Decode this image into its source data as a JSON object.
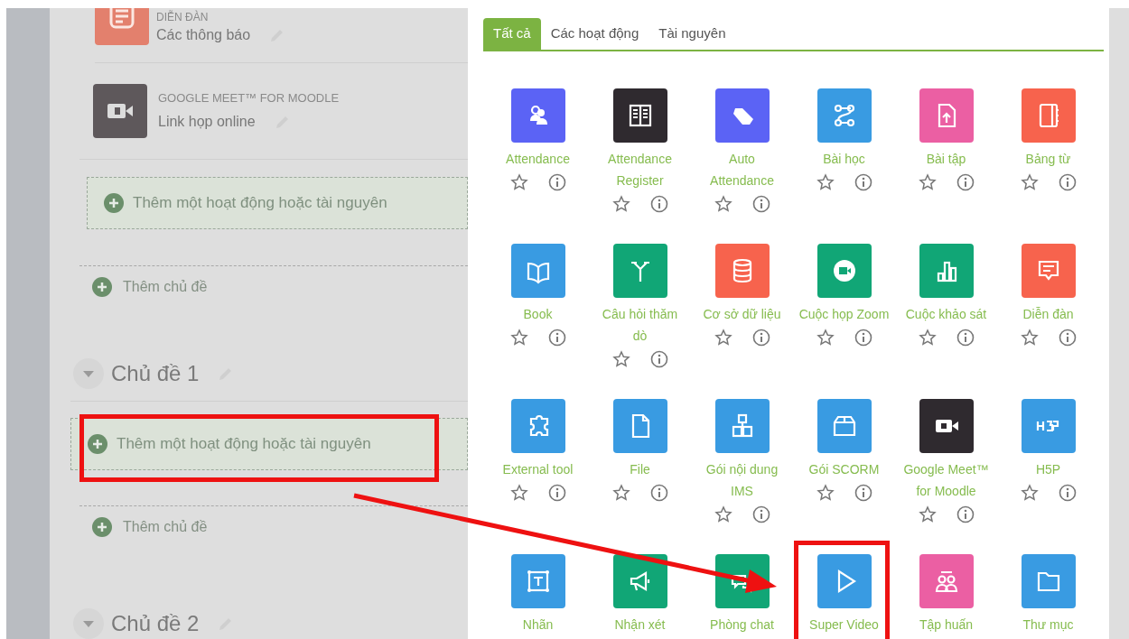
{
  "course": {
    "activities": [
      {
        "type_label": "DIỄN ĐÀN",
        "name": "Các thông báo",
        "color": "#e3806d"
      },
      {
        "type_label": "GOOGLE MEET™ FOR MOODLE",
        "name": "Link họp online",
        "color": "#5e585b"
      }
    ],
    "add_activity": "Thêm một hoạt động hoặc tài nguyên",
    "add_topic": "Thêm chủ đề",
    "sections": [
      {
        "title": "Chủ đề 1",
        "add_activity": "Thêm một hoạt động hoặc tài nguyên",
        "add_topic": "Thêm chủ đề"
      },
      {
        "title": "Chủ đề 2"
      }
    ]
  },
  "chooser": {
    "tabs": [
      {
        "label": "Tất cả",
        "selected": true
      },
      {
        "label": "Các hoạt động",
        "selected": false
      },
      {
        "label": "Tài nguyên",
        "selected": false
      }
    ],
    "items": [
      {
        "label": "Attendance",
        "color": "#5b63f5"
      },
      {
        "label": "Attendance Register",
        "color": "#2f2a2f"
      },
      {
        "label": "Auto Attendance",
        "color": "#5b63f5"
      },
      {
        "label": "Bài học",
        "color": "#399be2"
      },
      {
        "label": "Bài tập",
        "color": "#eb5fa3"
      },
      {
        "label": "Bảng từ",
        "color": "#f7634d"
      },
      {
        "label": "Book",
        "color": "#399be2"
      },
      {
        "label": "Câu hỏi thăm dò",
        "color": "#11a676"
      },
      {
        "label": "Cơ sở dữ liệu",
        "color": "#f7634d"
      },
      {
        "label": "Cuộc họp Zoom",
        "color": "#11a676"
      },
      {
        "label": "Cuộc khảo sát",
        "color": "#11a676"
      },
      {
        "label": "Diễn đàn",
        "color": "#f7634d"
      },
      {
        "label": "External tool",
        "color": "#399be2"
      },
      {
        "label": "File",
        "color": "#399be2"
      },
      {
        "label": "Gói nội dung IMS",
        "color": "#399be2"
      },
      {
        "label": "Gói SCORM",
        "color": "#399be2"
      },
      {
        "label": "Google Meet™ for Moodle",
        "color": "#2f2a2f"
      },
      {
        "label": "H5P",
        "color": "#399be2"
      },
      {
        "label": "Nhãn",
        "color": "#399be2"
      },
      {
        "label": "Nhận xét",
        "color": "#11a676"
      },
      {
        "label": "Phòng chat",
        "color": "#11a676"
      },
      {
        "label": "Super Video",
        "color": "#399be2"
      },
      {
        "label": "Tập huấn",
        "color": "#eb5fa3"
      },
      {
        "label": "Thư mục",
        "color": "#399be2"
      }
    ]
  }
}
